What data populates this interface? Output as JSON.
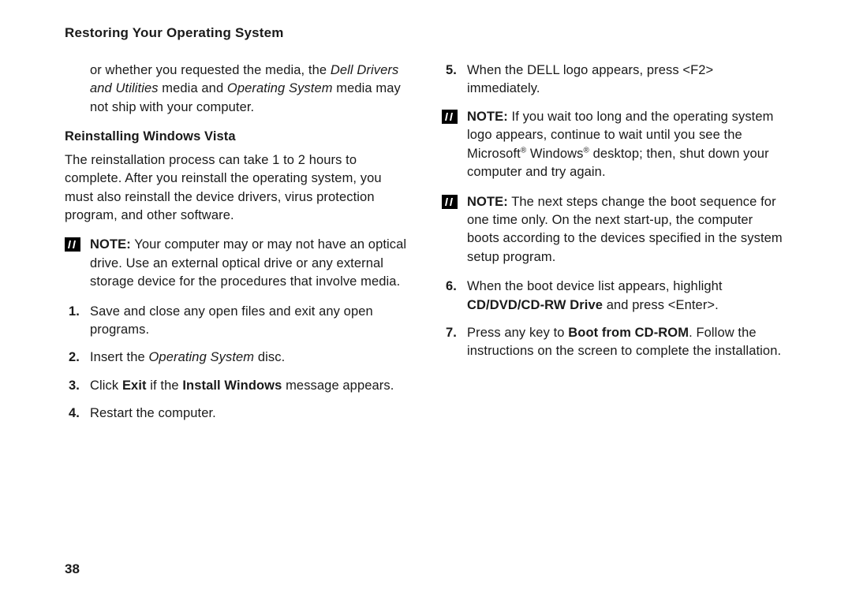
{
  "header": "Restoring Your Operating System",
  "pageNumber": "38",
  "left": {
    "contPara": {
      "pre": "or whether you requested the media, the ",
      "i1": "Dell Drivers and Utilities",
      "mid": " media and ",
      "i2": "Operating System",
      "post": " media may not ship with your computer."
    },
    "subHeading": "Reinstalling Windows Vista",
    "introPara": "The reinstallation process can take 1 to 2 hours to complete. After you reinstall the operating system, you must also reinstall the device drivers, virus protection program, and other software.",
    "note1": {
      "label": "NOTE:",
      "text": " Your computer may or may not have an optical drive. Use an external optical drive or any external storage device for the procedures that involve media."
    },
    "steps": {
      "s1": {
        "num": "1.",
        "text": "Save and close any open files and exit any open programs."
      },
      "s2": {
        "num": "2.",
        "pre": "Insert the ",
        "i1": "Operating System",
        "post": " disc."
      },
      "s3": {
        "num": "3.",
        "pre": "Click ",
        "b1": "Exit",
        "mid": " if the ",
        "b2": "Install Windows",
        "post": " message appears."
      },
      "s4": {
        "num": "4.",
        "text": "Restart the computer."
      }
    }
  },
  "right": {
    "s5": {
      "num": "5.",
      "text": "When the DELL logo appears, press <F2> immediately."
    },
    "note2": {
      "label": "NOTE:",
      "pre": " If you wait too long and the operating system logo appears, continue to wait until you see the Microsoft",
      "reg1": "®",
      "mid": " Windows",
      "reg2": "®",
      "post": " desktop; then, shut down your computer and try again."
    },
    "note3": {
      "label": "NOTE:",
      "text": " The next steps change the boot sequence for one time only. On the next start-up, the computer boots according to the devices specified in the system setup program."
    },
    "s6": {
      "num": "6.",
      "pre": "When the boot device list appears, highlight ",
      "b1": "CD/DVD/CD-RW Drive",
      "post": " and press <Enter>."
    },
    "s7": {
      "num": "7.",
      "pre": "Press any key to ",
      "b1": "Boot from CD-ROM",
      "post": ". Follow the instructions on the screen to complete the installation."
    }
  }
}
